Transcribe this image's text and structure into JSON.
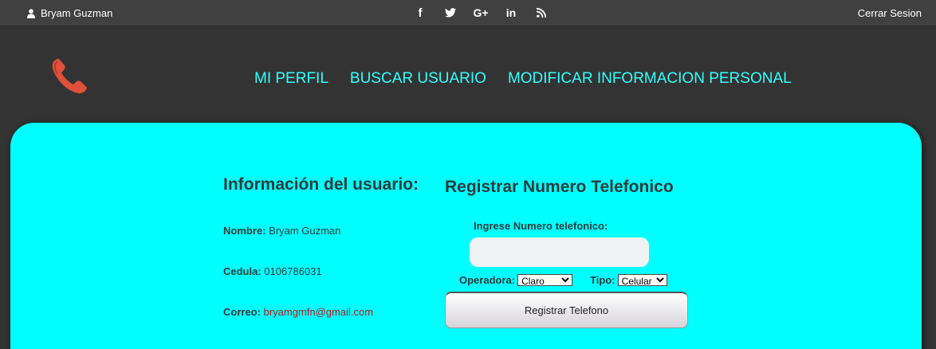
{
  "topbar": {
    "user_name": "Bryam Guzman",
    "logout_label": "Cerrar Sesion",
    "social_icons": [
      "facebook-icon",
      "twitter-icon",
      "google-plus-icon",
      "linkedin-icon",
      "rss-icon"
    ],
    "social_glyphs": {
      "facebook": "f",
      "google_plus": "G+",
      "linkedin": "in"
    }
  },
  "header": {
    "logo_icon": "phone-icon",
    "nav": [
      "MI PERFIL",
      "BUSCAR USUARIO",
      "MODIFICAR INFORMACION PERSONAL"
    ]
  },
  "user_info": {
    "title": "Información del usuario:",
    "name_label": "Nombre:",
    "name_value": "Bryam Guzman",
    "cedula_label": "Cedula:",
    "cedula_value": "0106786031",
    "correo_label": "Correo:",
    "correo_value": "bryamgmfn@gmail.com"
  },
  "register": {
    "title": "Registrar Numero Telefonico",
    "phone_label": "Ingrese Numero telefonico:",
    "phone_value": "",
    "operadora_label": "Operadora:",
    "operadora_value": "Claro",
    "tipo_label": "Tipo:",
    "tipo_value": "Celular",
    "submit_label": "Registrar Telefono"
  },
  "colors": {
    "topbar_bg": "#404040",
    "header_bg": "#333333",
    "nav_link": "#33ffff",
    "main_bg": "#00ffff",
    "email_text": "#c0101a",
    "logo_red": "#e0503a"
  }
}
